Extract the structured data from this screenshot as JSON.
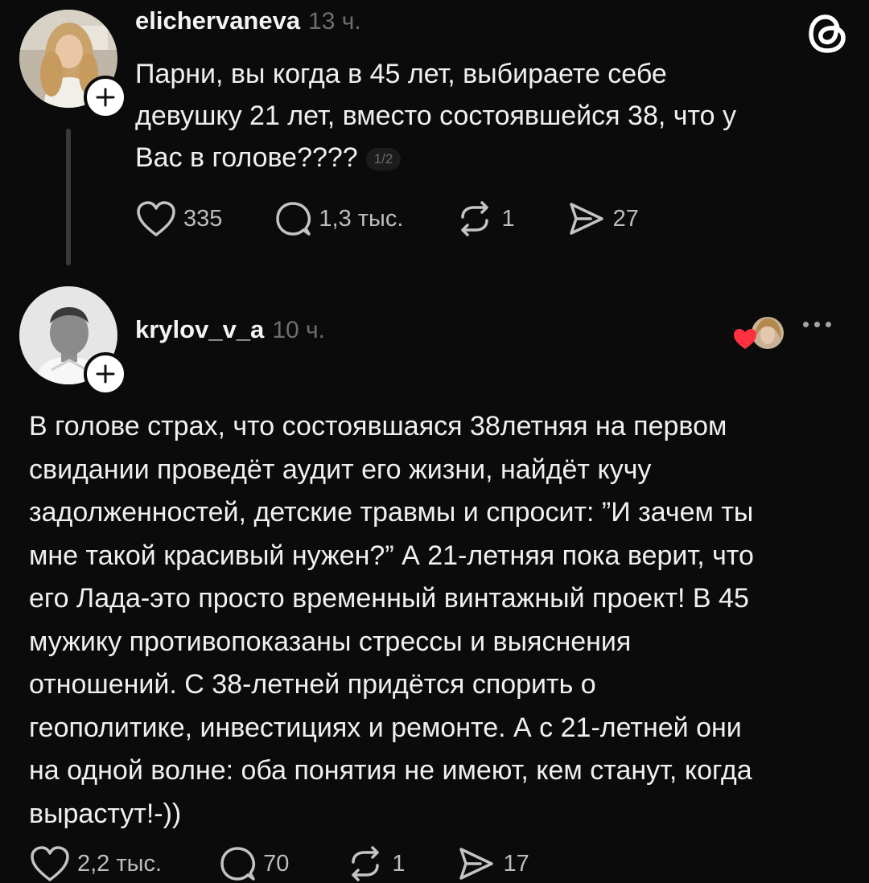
{
  "post": {
    "username": "elichervaneva",
    "time": "13 ч.",
    "text_lines": [
      "Парни, вы когда в 45 лет, выбираете себе",
      "девушку 21 лет, вместо состоявшейся 38, что у",
      "Вас в голове????"
    ],
    "page_indicator": "1/2",
    "likes": "335",
    "replies": "1,3 тыс.",
    "reposts": "1",
    "shares": "27"
  },
  "reply": {
    "username": "krylov_v_a",
    "time": "10 ч.",
    "text_lines": [
      "В голове страх, что состоявшаяся 38летняя на первом",
      "свидании проведёт аудит его жизни, найдёт кучу",
      "задолженностей, детские травмы и спросит: ”И зачем ты",
      "мне такой красивый нужен?” А 21-летняя пока верит, что",
      "его Лада-это просто временный винтажный проект! В 45",
      "мужику противопоказаны стрессы и выяснения",
      "отношений. С 38-летней придётся спорить о",
      "геополитике, инвестициях и ремонте. А с 21-летней они",
      "на одной волне: оба понятия не имеют, кем станут, когда",
      "вырастут!-))"
    ],
    "likes": "2,2 тыс.",
    "replies": "70",
    "reposts": "1",
    "shares": "17"
  },
  "icons": {
    "logo": "threads-logo-icon",
    "plus": "plus-icon",
    "heart": "heart-icon",
    "comment": "comment-icon",
    "repost": "repost-icon",
    "share": "send-icon",
    "more": "more-dots-icon",
    "liked_by": "liked-by-avatar-icon"
  },
  "colors": {
    "background": "#0b0b0b",
    "text": "#f0f0f0",
    "muted": "#6e6e6e",
    "like_heart": "#ff3040"
  }
}
